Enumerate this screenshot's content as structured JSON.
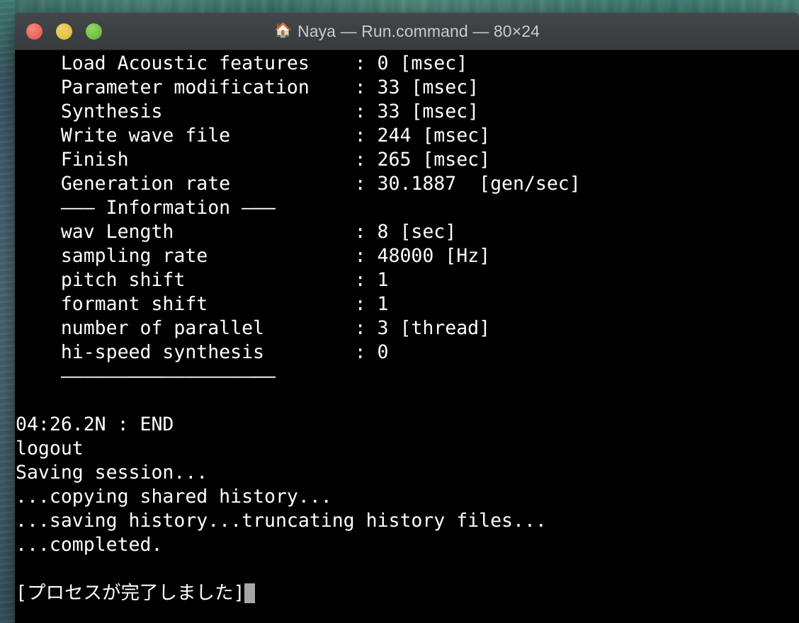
{
  "window": {
    "title_text": "Naya — Run.command — 80×24",
    "title_icon": "house-icon",
    "icon_glyph": "🏠",
    "controls": {
      "close_label": "",
      "minimize_label": "",
      "zoom_label": ""
    },
    "colors": {
      "close": "#e8655a",
      "minimize": "#e6c14a",
      "zoom": "#70c23f",
      "titlebar": "#3c4043",
      "terminal_bg": "#000000",
      "terminal_fg": "#ffffff",
      "cursor": "#a6a6a6"
    }
  },
  "terminal": {
    "cursor_visible": true,
    "lines": [
      "    Load Acoustic features    : 0 [msec]",
      "    Parameter modification    : 33 [msec]",
      "    Synthesis                 : 33 [msec]",
      "    Write wave file           : 244 [msec]",
      "    Finish                    : 265 [msec]",
      "    Generation rate           : 30.1887  [gen/sec]",
      "    ——— Information ———",
      "    wav Length                : 8 [sec]",
      "    sampling rate             : 48000 [Hz]",
      "    pitch shift               : 1",
      "    formant shift             : 1",
      "    number of parallel        : 3 [thread]",
      "    hi-speed synthesis        : 0",
      "    ———————————————————",
      "",
      "04:26.2N : END",
      "logout",
      "Saving session...",
      "...copying shared history...",
      "...saving history...truncating history files...",
      "...completed.",
      ""
    ],
    "prompt_line": "[プロセスが完了しました]",
    "stats": {
      "load_acoustic_features_msec": 0,
      "parameter_modification_msec": 33,
      "synthesis_msec": 33,
      "write_wave_file_msec": 244,
      "finish_msec": 265,
      "generation_rate_gen_per_sec": 30.1887,
      "wav_length_sec": 8,
      "sampling_rate_hz": 48000,
      "pitch_shift": 1,
      "formant_shift": 1,
      "number_of_parallel_threads": 3,
      "hi_speed_synthesis": 0
    }
  }
}
